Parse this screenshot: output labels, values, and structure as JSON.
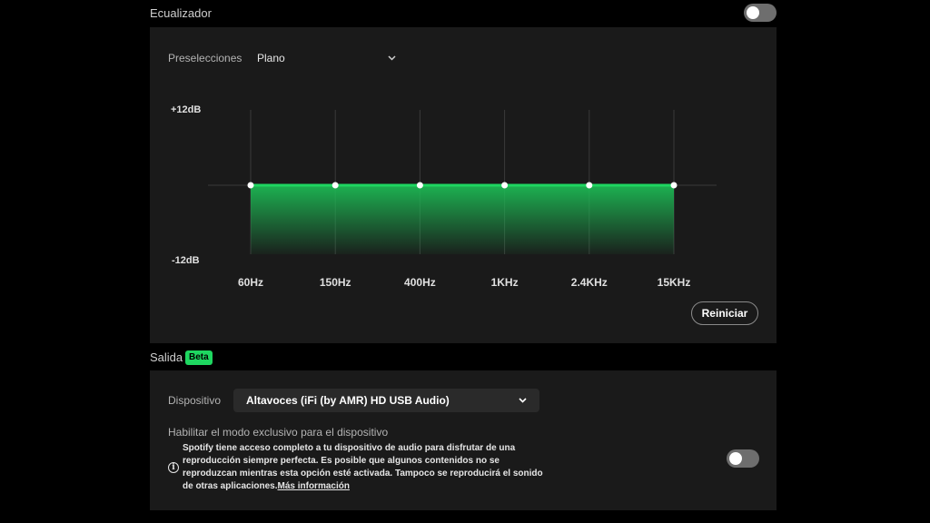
{
  "equalizer": {
    "title": "Ecualizador",
    "enabled": false,
    "presets_label": "Preselecciones",
    "preset_value": "Plano",
    "db_top": "+12dB",
    "db_bottom": "-12dB",
    "bands": [
      {
        "label": "60Hz",
        "gain_db": 0
      },
      {
        "label": "150Hz",
        "gain_db": 0
      },
      {
        "label": "400Hz",
        "gain_db": 0
      },
      {
        "label": "1KHz",
        "gain_db": 0
      },
      {
        "label": "2.4KHz",
        "gain_db": 0
      },
      {
        "label": "15KHz",
        "gain_db": 0
      }
    ],
    "reset_label": "Reiniciar",
    "accent_color": "#1ed760",
    "icons": {
      "preset_dropdown": "chevron-down-icon"
    }
  },
  "output": {
    "title": "Salida",
    "badge": "Beta",
    "device_label": "Dispositivo",
    "device_value": "Altavoces (iFi (by AMR) HD USB Audio)",
    "exclusive_title": "Habilitar el modo exclusivo para el dispositivo",
    "exclusive_info": "Spotify tiene acceso completo a tu dispositivo de audio para disfrutar de una reproducción siempre perfecta. Es posible que algunos contenidos no se reproduzcan mientras esta opción esté activada. Tampoco se reproducirá el sonido de otras aplicaciones.",
    "more_info_link": "Más información",
    "exclusive_enabled": false,
    "icons": {
      "device_dropdown": "chevron-down-icon",
      "info": "info-icon"
    }
  }
}
